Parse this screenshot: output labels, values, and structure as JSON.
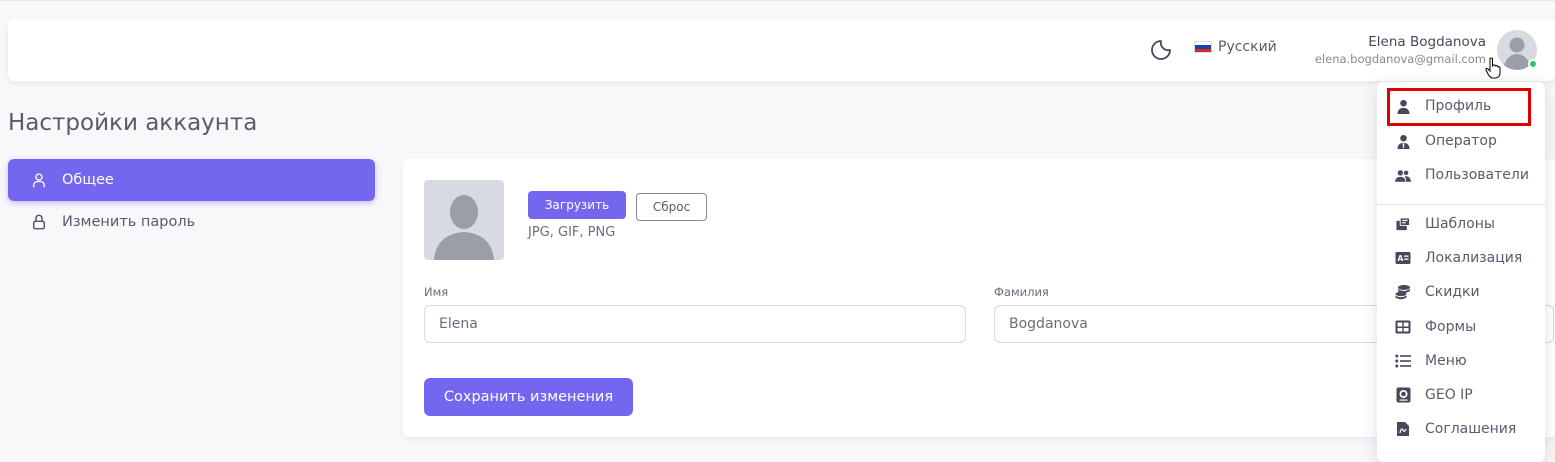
{
  "navbar": {
    "language": "Русский",
    "user_name": "Elena Bogdanova",
    "user_email": "elena.bogdanova@gmail.com",
    "status_color": "#28c76f"
  },
  "page": {
    "title": "Настройки аккаунта"
  },
  "sidebar": {
    "items": [
      {
        "label": "Общее",
        "icon": "user-icon",
        "active": true
      },
      {
        "label": "Изменить пароль",
        "icon": "lock-icon",
        "active": false
      }
    ]
  },
  "profile_form": {
    "upload_label": "Загрузить",
    "reset_label": "Сброс",
    "file_hint": "JPG, GIF, PNG",
    "first_name_label": "Имя",
    "first_name_value": "Elena",
    "last_name_label": "Фамилия",
    "last_name_value": "Bogdanova",
    "save_label": "Сохранить изменения"
  },
  "dropdown": {
    "items": [
      {
        "label": "Профиль",
        "icon": "user-icon"
      },
      {
        "label": "Оператор",
        "icon": "operator-icon"
      },
      {
        "label": "Пользователи",
        "icon": "users-icon"
      },
      {
        "label": "Шаблоны",
        "icon": "templates-icon"
      },
      {
        "label": "Локализация",
        "icon": "localization-icon"
      },
      {
        "label": "Скидки",
        "icon": "coins-icon"
      },
      {
        "label": "Формы",
        "icon": "forms-icon"
      },
      {
        "label": "Меню",
        "icon": "menu-list-icon"
      },
      {
        "label": "GEO IP",
        "icon": "geo-icon"
      },
      {
        "label": "Соглашения",
        "icon": "document-icon"
      }
    ]
  },
  "colors": {
    "primary": "#7367f0",
    "highlight": "#e00000"
  }
}
